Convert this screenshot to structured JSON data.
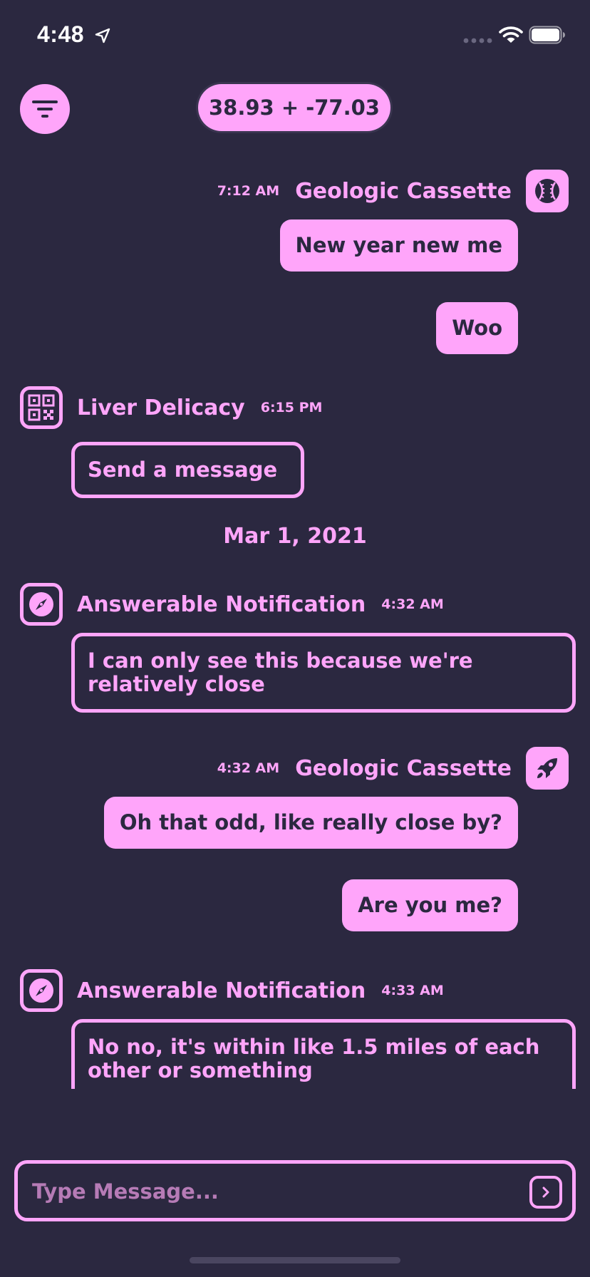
{
  "status_bar": {
    "time": "4:48"
  },
  "header": {
    "coordinates": "38.93 + -77.03"
  },
  "messages": [
    {
      "sender": "Geologic Cassette",
      "time": "7:12 AM",
      "avatar_icon": "baseball-icon",
      "texts": [
        "New year new me",
        "Woo"
      ]
    },
    {
      "sender": "Liver Delicacy",
      "time": "6:15 PM",
      "avatar_icon": "qr-code-icon",
      "texts": [
        "Send a message"
      ]
    },
    {
      "date_separator": "Mar 1, 2021"
    },
    {
      "sender": "Answerable Notification",
      "time": "4:32 AM",
      "avatar_icon": "compass-icon",
      "texts": [
        "I can only see this because we're relatively close"
      ]
    },
    {
      "sender": "Geologic Cassette",
      "time": "4:32 AM",
      "avatar_icon": "rocket-icon",
      "texts": [
        "Oh that odd, like really close by?",
        "Are you me?"
      ]
    },
    {
      "sender": "Answerable Notification",
      "time": "4:33 AM",
      "avatar_icon": "compass-icon",
      "texts": [
        "No no, it's within like 1.5 miles of each other  or something"
      ]
    }
  ],
  "composer": {
    "placeholder": "Type Message..."
  },
  "colors": {
    "background": "#2b2840",
    "accent": "#ffa5fa"
  }
}
